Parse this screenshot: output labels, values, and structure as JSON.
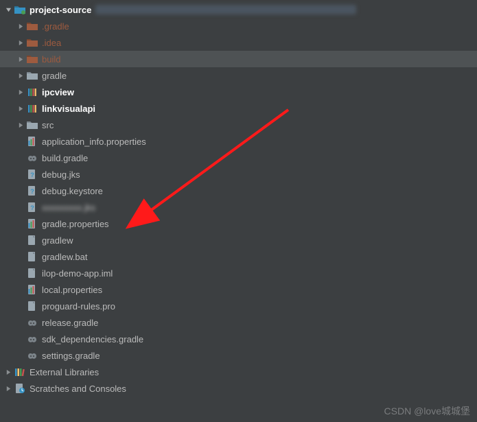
{
  "tree": {
    "root": {
      "label": "project-source",
      "expanded": true
    },
    "children": [
      {
        "label": ".gradle",
        "type": "folder-excluded",
        "chevron": true
      },
      {
        "label": ".idea",
        "type": "folder-excluded",
        "chevron": true
      },
      {
        "label": "build",
        "type": "folder-excluded",
        "chevron": true,
        "highlight": true
      },
      {
        "label": "gradle",
        "type": "folder",
        "chevron": true
      },
      {
        "label": "ipcview",
        "type": "module",
        "chevron": true
      },
      {
        "label": "linkvisualapi",
        "type": "module",
        "chevron": true
      },
      {
        "label": "src",
        "type": "folder",
        "chevron": true
      },
      {
        "label": "application_info.properties",
        "type": "properties"
      },
      {
        "label": "build.gradle",
        "type": "gradle"
      },
      {
        "label": "debug.jks",
        "type": "unknown"
      },
      {
        "label": "debug.keystore",
        "type": "unknown"
      },
      {
        "label": "xxxxxxxxx.jks",
        "type": "unknown",
        "blurred": true
      },
      {
        "label": "gradle.properties",
        "type": "properties"
      },
      {
        "label": "gradlew",
        "type": "file"
      },
      {
        "label": "gradlew.bat",
        "type": "file"
      },
      {
        "label": "ilop-demo-app.iml",
        "type": "file"
      },
      {
        "label": "local.properties",
        "type": "properties"
      },
      {
        "label": "proguard-rules.pro",
        "type": "file"
      },
      {
        "label": "release.gradle",
        "type": "gradle"
      },
      {
        "label": "sdk_dependencies.gradle",
        "type": "gradle"
      },
      {
        "label": "settings.gradle",
        "type": "gradle"
      }
    ],
    "siblings": [
      {
        "label": "External Libraries",
        "type": "libraries",
        "chevron": true
      },
      {
        "label": "Scratches and Consoles",
        "type": "scratches",
        "chevron": true
      }
    ]
  },
  "watermark": "CSDN @love城城堡",
  "colors": {
    "excluded": "#9e5b3f",
    "folder": "#9aa7b0",
    "module_bars": [
      "#3592c4",
      "#499c54",
      "#c75450",
      "#ffc66d"
    ],
    "arrow": "#ff1a1a"
  }
}
